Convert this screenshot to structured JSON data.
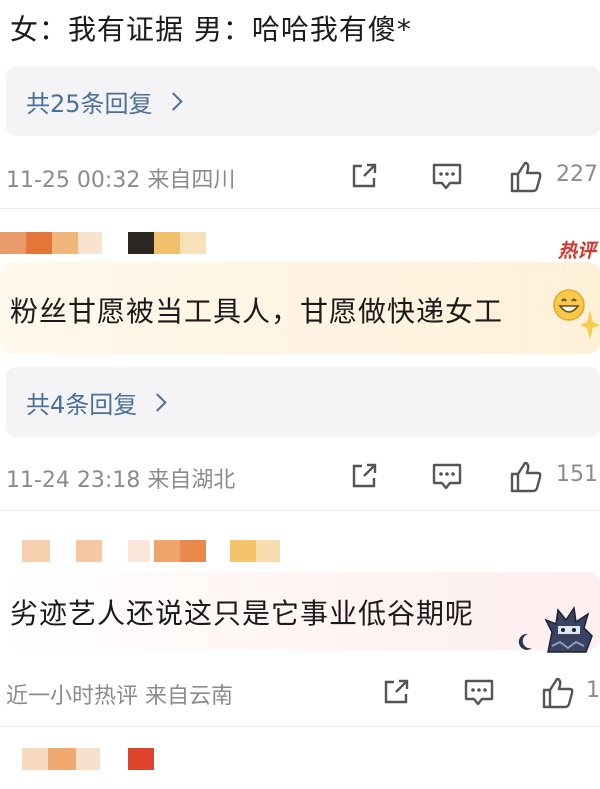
{
  "top_comment": {
    "text": "女：我有证据 男：哈哈我有傻*"
  },
  "comments": [
    {
      "reply_label": "共25条回复",
      "meta": "11-25 00:32  来自四川",
      "likes": "227"
    },
    {
      "hot_tag": "热评",
      "text": "粉丝甘愿被当工具人，甘愿做快递女工",
      "reply_label": "共4条回复",
      "meta": "11-24 23:18  来自湖北",
      "likes": "151"
    },
    {
      "text": "劣迹艺人还说这只是它事业低谷期呢",
      "meta": "近一小时热评  来自云南",
      "likes": "1"
    }
  ],
  "icons": {
    "share": "share-icon",
    "comment": "comment-icon",
    "like": "thumbs-up-icon",
    "emoji": "grinning-emoji-icon",
    "moon": "moon-icon",
    "sticker": "ninja-sticker-icon"
  },
  "colors": {
    "reply_link": "#4a6f9a",
    "meta_gray": "#8b8b8b",
    "reply_bg": "#f4f4f6",
    "hot_red": "#d9342b"
  }
}
